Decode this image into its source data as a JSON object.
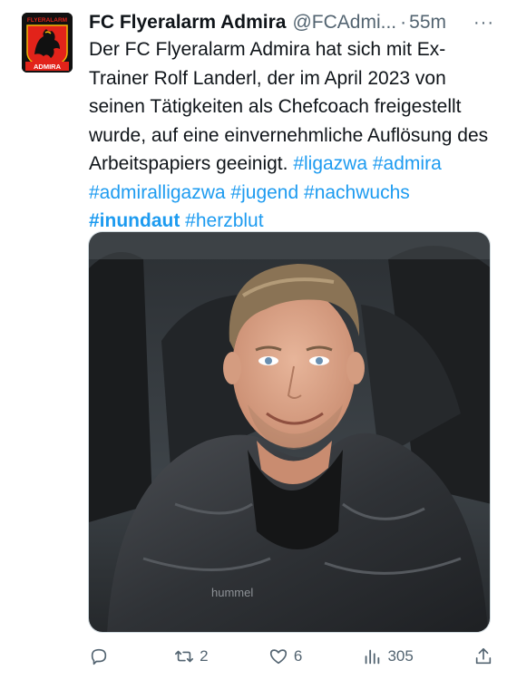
{
  "tweet": {
    "author_name": "FC Flyeralarm Admira",
    "handle": "@FCAdmi...",
    "separator": "·",
    "time": "55m",
    "more": "···",
    "avatar": {
      "logo_top_text": "FLYERALARM",
      "logo_bottom_text": "ADMIRA",
      "colors": {
        "red": "#e2231a",
        "black": "#111111",
        "gold": "#f2b705"
      }
    },
    "text": "Der FC Flyeralarm Admira hat sich mit Ex-Trainer Rolf Landerl, der im April 2023 von seinen Tätigkeiten als Chefcoach freigestellt wurde, auf eine einvernehmliche Auflösung des Arbeitspapiers geeinigt.",
    "hashtags": [
      "#ligazwa",
      "#admira",
      "#admiralligazwa",
      "#jugend",
      "#nachwuchs",
      "#inundaut",
      "#herzblut"
    ],
    "media": {
      "jacket_logo": "hummel"
    }
  },
  "actions": {
    "reply": {
      "icon": "reply-icon",
      "count": ""
    },
    "retweet": {
      "icon": "retweet-icon",
      "count": "2"
    },
    "like": {
      "icon": "like-icon",
      "count": "6"
    },
    "views": {
      "icon": "views-icon",
      "count": "305"
    },
    "share": {
      "icon": "share-icon"
    }
  },
  "colors": {
    "link": "#1d9bf0",
    "secondary": "#536471",
    "text": "#0f1419"
  }
}
